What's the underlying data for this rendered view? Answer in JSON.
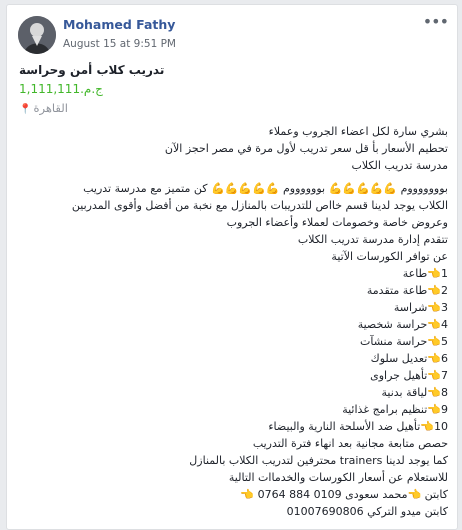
{
  "post": {
    "author": "Mohamed Fathy",
    "timestamp": "August 15 at 9:51 PM",
    "title": "تدريب كلاب أمن وحراسة",
    "price": "ج.م.‏1,111,111‏",
    "location": "القاهرة",
    "lines_a": [
      "بشري سارة لكل اعضاء الجروب وعملاء",
      "تحطيم الأسعار بأ قل سعر تدريب لأول مرة في مصر احجز الآن",
      "مدرسة تدريب الكلاب"
    ],
    "lines_b": [
      "بوووووووم 💪💪💪💪💪 بووووووم 💪💪💪💪💪 كن متميز مع مدرسة تدريب",
      "الكلاب يوجد لدينا قسم خااص للتدريبات بالمنازل مع نخبة من أفضل وأقوى المدربين",
      "وعروض خاصة وخصومات لعملاء وأعضاء الجروب",
      "تتقدم إدارة مدرسة تدريب الكلاب",
      "عن توافر الكورسات الآتية",
      "1👈طاعة",
      "2👈طاعة متقدمة",
      "3👈شراسة",
      "4👈حراسة شخصية",
      "5👈حراسة منشآت",
      "6👈تعديل سلوك",
      "7👈تأهيل جراوى",
      "8👈لياقة بدنية",
      "9👈تنظيم برامج غذائية",
      "10👈تأهيل ضد الأسلحة النارية والبيضاء",
      "حصص متابعة مجانية بعد انهاء فترة التدريب",
      "كما يوجد لدينا trainers محترفين لتدريب الكلاب بالمنازل",
      "للاستعلام عن أسعار الكورسات والخدماات التالية",
      "كابتن 👈محمد سعودى 0109 884 0764 👈",
      "كابتن ميدو التركي 01007690806"
    ]
  }
}
